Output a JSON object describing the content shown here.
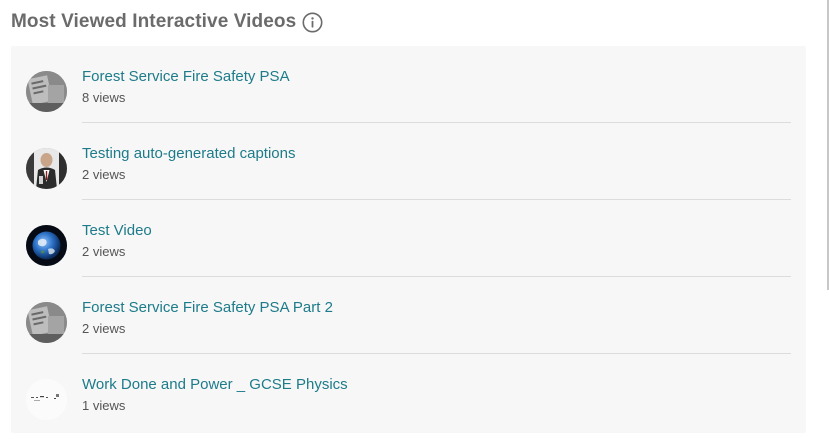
{
  "widget": {
    "title": "Most Viewed Interactive Videos",
    "info_icon": "info-circle-icon"
  },
  "videos": [
    {
      "title": "Forest Service Fire Safety PSA",
      "views": "8 views",
      "thumbnail": "grayscale-documents"
    },
    {
      "title": "Testing auto-generated captions",
      "views": "2 views",
      "thumbnail": "person-in-suit"
    },
    {
      "title": "Test Video",
      "views": "2 views",
      "thumbnail": "earth-from-space"
    },
    {
      "title": "Forest Service Fire Safety PSA Part 2",
      "views": "2 views",
      "thumbnail": "grayscale-documents"
    },
    {
      "title": "Work Done and Power _ GCSE Physics",
      "views": "1 views",
      "thumbnail": "whiteboard-sketch"
    }
  ],
  "colors": {
    "link": "#1d7b8a",
    "panel_bg": "#f7f7f7",
    "divider": "#dcdcdc",
    "title": "#6b6b6b"
  }
}
